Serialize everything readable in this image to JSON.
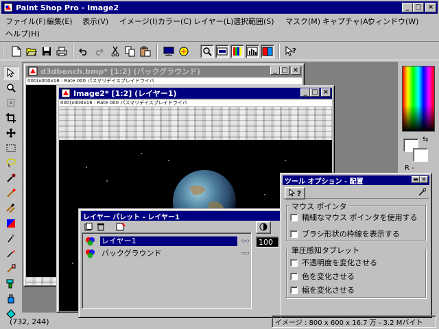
{
  "app": {
    "title": "Paint Shop Pro - Image2",
    "caption_min": "_",
    "caption_max": "□",
    "caption_close": "×"
  },
  "menu": [
    "ファイル(F)",
    "編集(E)",
    "表示(V)",
    "イメージ(I)",
    "カラー(C)",
    "レイヤー(L)",
    "選択範囲(S)",
    "マスク(M)",
    "キャプチャ(A)",
    "ウィンドウ(W)",
    "ヘルプ(H)"
  ],
  "toolbar_icons": [
    "new-file-icon",
    "open-folder-icon",
    "save-icon",
    "print-icon",
    "undo-icon",
    "redo-icon",
    "cut-icon",
    "copy-icon",
    "paste-icon",
    "view-screen-icon",
    "browse-icon",
    "zoom-icon",
    "histogram-icon",
    "color-palette-icon",
    "layers-icon",
    "tool-options-icon",
    "help-pointer-icon"
  ],
  "tool_icons": [
    "arrow-icon",
    "zoom-tool-icon",
    "deform-icon",
    "crop-icon",
    "mover-icon",
    "selection-icon",
    "freehand-lasso-icon",
    "dropper-icon",
    "paintbrush-icon",
    "clone-brush-icon",
    "color-replacer-icon",
    "retouch-icon",
    "scratch-remover-icon",
    "eraser-icon",
    "picture-tube-icon",
    "airbrush-icon",
    "flood-fill-icon"
  ],
  "window_back": {
    "title": "d3dbench.bmp* [1:2] (バックグラウンド)",
    "ruler_text": "000(x000x16 : Rate   000 パスマリデイスプレイドライバ"
  },
  "window_front": {
    "title": "Image2* [1:2] (レイヤー1)",
    "ruler_text": "000(x000x16 : Rate   000 パスマリデイスプレイドライバ"
  },
  "layer_palette": {
    "title": "レイヤー パレット - レイヤー1",
    "layers": [
      {
        "name": "レイヤー1",
        "selected": true
      },
      {
        "name": "バックグラウンド",
        "selected": false
      }
    ],
    "opacity": "100"
  },
  "tool_options": {
    "title": "ツール オプション - 配置",
    "group_mouse": "マウス ポインタ",
    "opt_precise": "精細なマウス ポインタを使用する",
    "opt_brush_outline": "ブラシ形状の枠線を表示する",
    "group_pressure": "筆圧感知タブレット",
    "opt_opacity": "不透明度を変化させる",
    "opt_color": "色を変化させる",
    "opt_width": "幅を変化させる"
  },
  "status": {
    "coords": "(732, 244)",
    "image_info": "イメージ : 800 x 600 x 16.7 万 - 3.2 Mバイト"
  },
  "colors": {
    "title_active": "#000080",
    "title_inactive": "#808080",
    "face": "#c0c0c0",
    "selection": "#000080"
  },
  "color_panel_label": "R -"
}
